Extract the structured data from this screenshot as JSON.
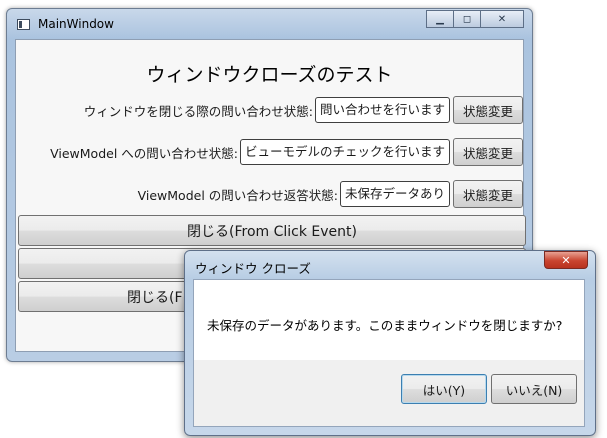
{
  "window": {
    "title": "MainWindow",
    "minimize_glyph": "▁",
    "maximize_glyph": "◻",
    "close_glyph": "✕"
  },
  "heading": "ウィンドウクローズのテスト",
  "rows": [
    {
      "label": "ウィンドウを閉じる際の問い合わせ状態:",
      "status": "問い合わせを行います",
      "button": "状態変更"
    },
    {
      "label": "ViewModel への問い合わせ状態:",
      "status": "ビューモデルのチェックを行います",
      "button": "状態変更"
    },
    {
      "label": "ViewModel の問い合わせ返答状態:",
      "status": "未保存データあり",
      "button": "状態変更"
    }
  ],
  "close_buttons": [
    {
      "label": "閉じる(From Click Event)"
    },
    {
      "label": ""
    },
    {
      "label": "閉じる(F"
    }
  ],
  "dialog": {
    "title": "ウィンドウ クローズ",
    "close_glyph": "✕",
    "message": "未保存のデータがあります。このままウィンドウを閉じますか?",
    "yes_label": "はい(Y)",
    "no_label": "いいえ(N)"
  },
  "colors": {
    "window_frame": "#aac3df",
    "dialog_close": "#c9442f"
  }
}
